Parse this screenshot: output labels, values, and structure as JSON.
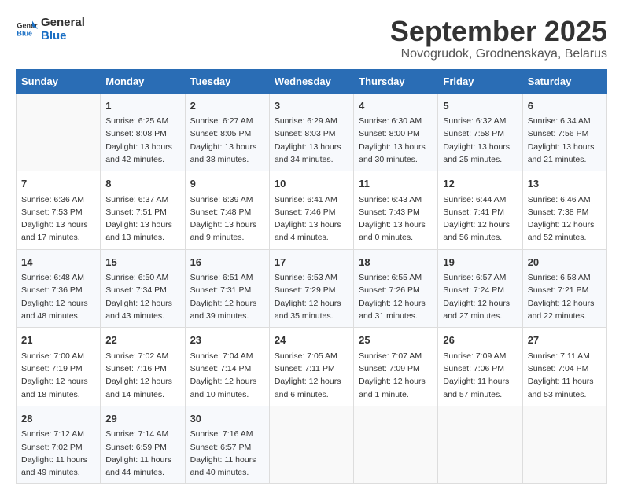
{
  "logo": {
    "line1": "General",
    "line2": "Blue"
  },
  "title": "September 2025",
  "subtitle": "Novogrudok, Grodnenskaya, Belarus",
  "days_of_week": [
    "Sunday",
    "Monday",
    "Tuesday",
    "Wednesday",
    "Thursday",
    "Friday",
    "Saturday"
  ],
  "weeks": [
    [
      {
        "day": "",
        "info": ""
      },
      {
        "day": "1",
        "info": "Sunrise: 6:25 AM\nSunset: 8:08 PM\nDaylight: 13 hours\nand 42 minutes."
      },
      {
        "day": "2",
        "info": "Sunrise: 6:27 AM\nSunset: 8:05 PM\nDaylight: 13 hours\nand 38 minutes."
      },
      {
        "day": "3",
        "info": "Sunrise: 6:29 AM\nSunset: 8:03 PM\nDaylight: 13 hours\nand 34 minutes."
      },
      {
        "day": "4",
        "info": "Sunrise: 6:30 AM\nSunset: 8:00 PM\nDaylight: 13 hours\nand 30 minutes."
      },
      {
        "day": "5",
        "info": "Sunrise: 6:32 AM\nSunset: 7:58 PM\nDaylight: 13 hours\nand 25 minutes."
      },
      {
        "day": "6",
        "info": "Sunrise: 6:34 AM\nSunset: 7:56 PM\nDaylight: 13 hours\nand 21 minutes."
      }
    ],
    [
      {
        "day": "7",
        "info": "Sunrise: 6:36 AM\nSunset: 7:53 PM\nDaylight: 13 hours\nand 17 minutes."
      },
      {
        "day": "8",
        "info": "Sunrise: 6:37 AM\nSunset: 7:51 PM\nDaylight: 13 hours\nand 13 minutes."
      },
      {
        "day": "9",
        "info": "Sunrise: 6:39 AM\nSunset: 7:48 PM\nDaylight: 13 hours\nand 9 minutes."
      },
      {
        "day": "10",
        "info": "Sunrise: 6:41 AM\nSunset: 7:46 PM\nDaylight: 13 hours\nand 4 minutes."
      },
      {
        "day": "11",
        "info": "Sunrise: 6:43 AM\nSunset: 7:43 PM\nDaylight: 13 hours\nand 0 minutes."
      },
      {
        "day": "12",
        "info": "Sunrise: 6:44 AM\nSunset: 7:41 PM\nDaylight: 12 hours\nand 56 minutes."
      },
      {
        "day": "13",
        "info": "Sunrise: 6:46 AM\nSunset: 7:38 PM\nDaylight: 12 hours\nand 52 minutes."
      }
    ],
    [
      {
        "day": "14",
        "info": "Sunrise: 6:48 AM\nSunset: 7:36 PM\nDaylight: 12 hours\nand 48 minutes."
      },
      {
        "day": "15",
        "info": "Sunrise: 6:50 AM\nSunset: 7:34 PM\nDaylight: 12 hours\nand 43 minutes."
      },
      {
        "day": "16",
        "info": "Sunrise: 6:51 AM\nSunset: 7:31 PM\nDaylight: 12 hours\nand 39 minutes."
      },
      {
        "day": "17",
        "info": "Sunrise: 6:53 AM\nSunset: 7:29 PM\nDaylight: 12 hours\nand 35 minutes."
      },
      {
        "day": "18",
        "info": "Sunrise: 6:55 AM\nSunset: 7:26 PM\nDaylight: 12 hours\nand 31 minutes."
      },
      {
        "day": "19",
        "info": "Sunrise: 6:57 AM\nSunset: 7:24 PM\nDaylight: 12 hours\nand 27 minutes."
      },
      {
        "day": "20",
        "info": "Sunrise: 6:58 AM\nSunset: 7:21 PM\nDaylight: 12 hours\nand 22 minutes."
      }
    ],
    [
      {
        "day": "21",
        "info": "Sunrise: 7:00 AM\nSunset: 7:19 PM\nDaylight: 12 hours\nand 18 minutes."
      },
      {
        "day": "22",
        "info": "Sunrise: 7:02 AM\nSunset: 7:16 PM\nDaylight: 12 hours\nand 14 minutes."
      },
      {
        "day": "23",
        "info": "Sunrise: 7:04 AM\nSunset: 7:14 PM\nDaylight: 12 hours\nand 10 minutes."
      },
      {
        "day": "24",
        "info": "Sunrise: 7:05 AM\nSunset: 7:11 PM\nDaylight: 12 hours\nand 6 minutes."
      },
      {
        "day": "25",
        "info": "Sunrise: 7:07 AM\nSunset: 7:09 PM\nDaylight: 12 hours\nand 1 minute."
      },
      {
        "day": "26",
        "info": "Sunrise: 7:09 AM\nSunset: 7:06 PM\nDaylight: 11 hours\nand 57 minutes."
      },
      {
        "day": "27",
        "info": "Sunrise: 7:11 AM\nSunset: 7:04 PM\nDaylight: 11 hours\nand 53 minutes."
      }
    ],
    [
      {
        "day": "28",
        "info": "Sunrise: 7:12 AM\nSunset: 7:02 PM\nDaylight: 11 hours\nand 49 minutes."
      },
      {
        "day": "29",
        "info": "Sunrise: 7:14 AM\nSunset: 6:59 PM\nDaylight: 11 hours\nand 44 minutes."
      },
      {
        "day": "30",
        "info": "Sunrise: 7:16 AM\nSunset: 6:57 PM\nDaylight: 11 hours\nand 40 minutes."
      },
      {
        "day": "",
        "info": ""
      },
      {
        "day": "",
        "info": ""
      },
      {
        "day": "",
        "info": ""
      },
      {
        "day": "",
        "info": ""
      }
    ]
  ]
}
